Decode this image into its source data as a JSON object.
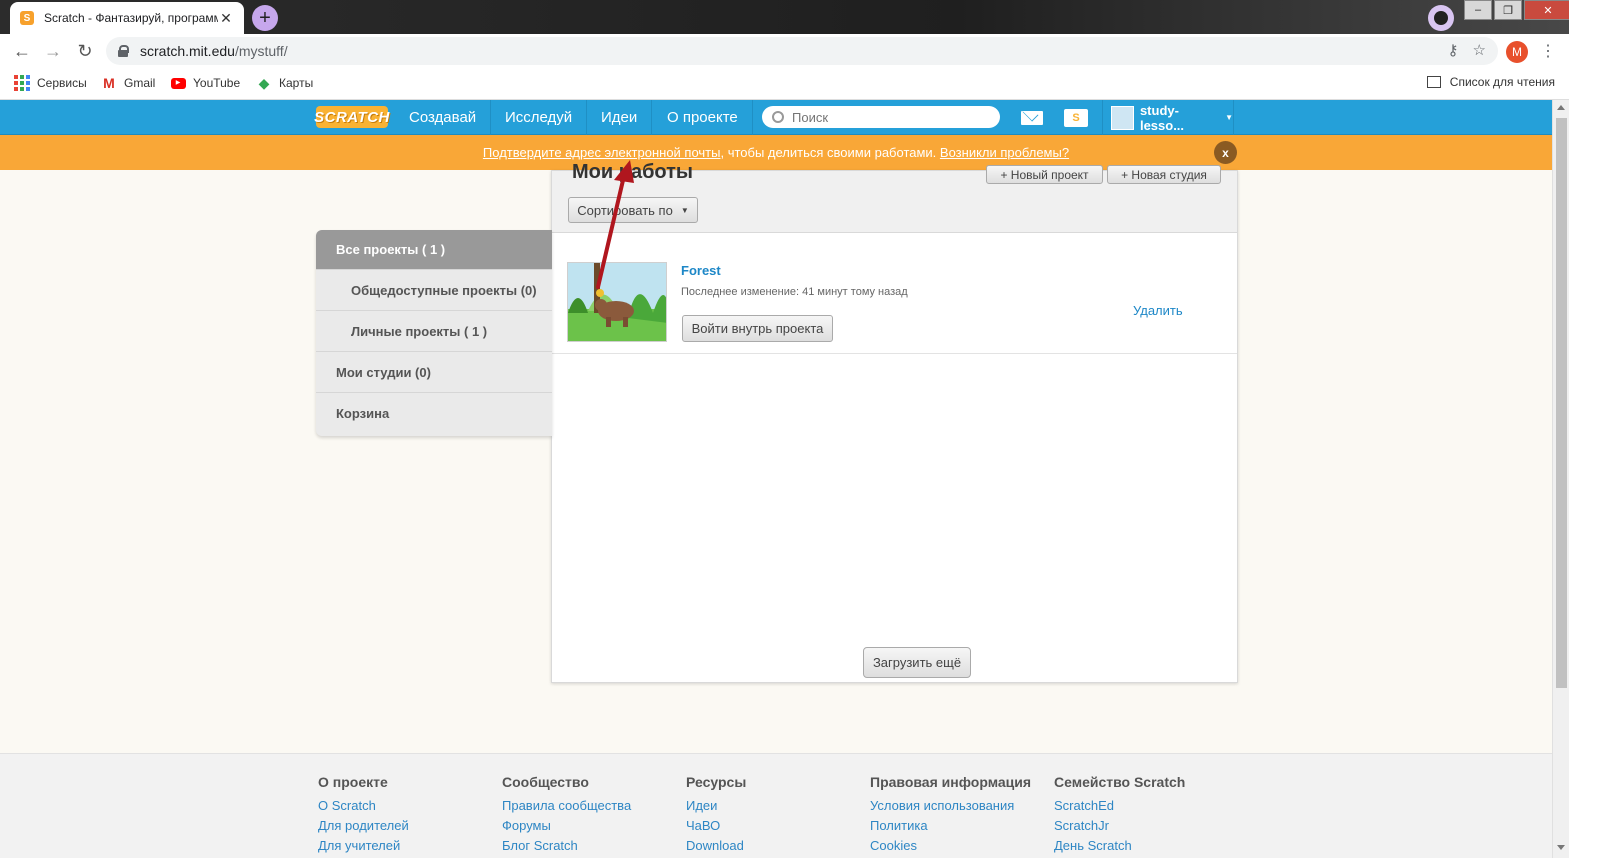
{
  "browser": {
    "tab_title": "Scratch - Фантазируй, программ",
    "url_host": "scratch.mit.edu",
    "url_path": "/mystuff/",
    "profile_letter": "M",
    "bookmarks": [
      "Сервисы",
      "Gmail",
      "YouTube",
      "Карты"
    ],
    "reading_list": "Список для чтения"
  },
  "nav": {
    "logo": "SCRATCH",
    "links": [
      "Создавай",
      "Исследуй",
      "Идеи",
      "О проекте"
    ],
    "search_placeholder": "Поиск",
    "username": "study-lesso..."
  },
  "banner": {
    "link1": "Подтвердите адрес электронной почты",
    "middle": ", чтобы делиться своими работами.",
    "link2": "Возникли проблемы?",
    "close": "x"
  },
  "sidebar": {
    "items": [
      "Все проекты ( 1 )",
      "Общедоступные проекты (0)",
      "Личные проекты ( 1 )",
      "Мои студии (0)",
      "Корзина"
    ]
  },
  "main": {
    "title": "Мои работы",
    "new_project": "+ Новый проект",
    "new_studio": "+ Новая студия",
    "sort_label": "Сортировать по",
    "load_more": "Загрузить ещё"
  },
  "project": {
    "title": "Forest",
    "meta": "Последнее изменение: 41 минут тому назад",
    "enter_button": "Войти внутрь проекта",
    "delete": "Удалить"
  },
  "footer": {
    "columns": [
      {
        "heading": "О проекте",
        "links": [
          "О Scratch",
          "Для родителей",
          "Для учителей"
        ]
      },
      {
        "heading": "Сообщество",
        "links": [
          "Правила сообщества",
          "Форумы",
          "Блог Scratch"
        ]
      },
      {
        "heading": "Ресурсы",
        "links": [
          "Идеи",
          "ЧаВО",
          "Download"
        ]
      },
      {
        "heading": "Правовая информация",
        "links": [
          "Условия использования",
          "Политика",
          "Cookies"
        ]
      },
      {
        "heading": "Семейство Scratch",
        "links": [
          "ScratchEd",
          "ScratchJr",
          "День Scratch"
        ]
      }
    ]
  },
  "colors": {
    "nav_blue": "#25a0d9",
    "banner_orange": "#f9a737",
    "link_blue": "#1d87c7",
    "arrow_red": "#b0161e"
  }
}
